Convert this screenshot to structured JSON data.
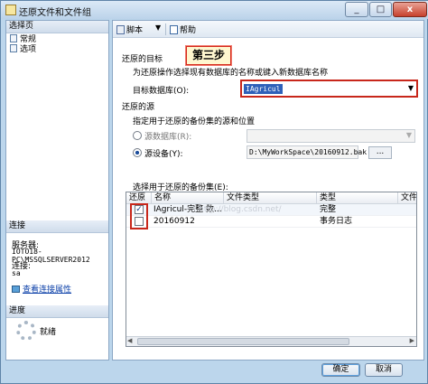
{
  "window": {
    "title": "还原文件和文件组",
    "close_glyph": "x",
    "min_glyph": "_",
    "max_glyph": "□"
  },
  "left": {
    "select_page": "选择页",
    "nav": [
      "常规",
      "选项"
    ],
    "connection": "连接",
    "server_label": "服务器:",
    "server_value": "IOTO18-PC\\MSSQLSERVER2012",
    "conn_label": "连接:",
    "conn_value": "sa",
    "view_props": "查看连接属性",
    "progress": "进度",
    "ready": "就绪"
  },
  "toolbar": {
    "script": "脚本",
    "help": "帮助"
  },
  "step_label": "第三步",
  "target": {
    "title": "还原的目标",
    "desc": "为还原操作选择现有数据库的名称或键入新数据库名称",
    "db_label": "目标数据库(O):",
    "db_value": "IAgricul"
  },
  "source": {
    "title": "还原的源",
    "desc": "指定用于还原的备份集的源和位置",
    "srcdb_label": "源数据库(R):",
    "device_label": "源设备(Y):",
    "device_value": "D:\\MyWorkSpace\\20160912.bak",
    "browse": "..."
  },
  "backup_sets": {
    "title": "选择用于还原的备份集(E):",
    "columns": [
      "还原",
      "名称",
      "文件类型",
      "类型",
      "文件"
    ],
    "rows": [
      {
        "checked": true,
        "check_glyph": "✓",
        "name": "IAgricul-完整 数...",
        "type": "完整"
      },
      {
        "checked": false,
        "check_glyph": "",
        "name": "20160912",
        "type": "事务日志"
      }
    ],
    "watermark": "http://blog.csdn.net/"
  },
  "buttons": {
    "ok": "确定",
    "cancel": "取消"
  }
}
